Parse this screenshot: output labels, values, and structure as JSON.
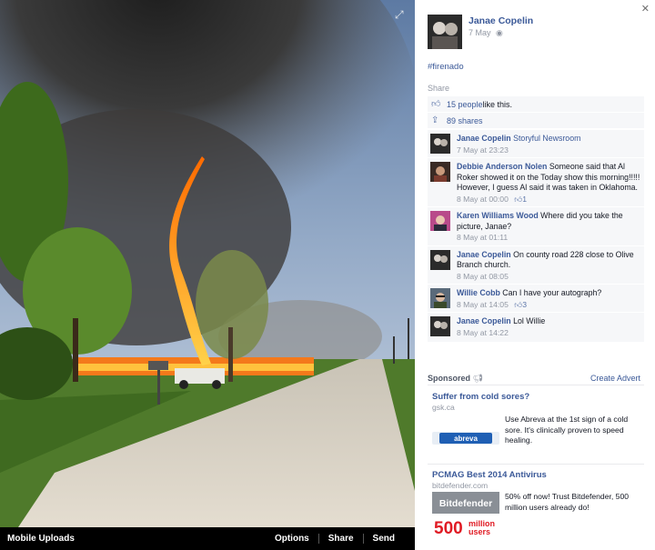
{
  "stage": {
    "album": "Mobile Uploads",
    "actions": [
      "Options",
      "Share",
      "Send"
    ]
  },
  "post": {
    "owner": "Janae Copelin",
    "date": "7 May",
    "caption": "#firenado",
    "share_label": "Share",
    "likes_text": "15 people",
    "likes_suffix": " like this.",
    "shares_text": "89 shares"
  },
  "comments": [
    {
      "name": "Janae Copelin",
      "text": "Storyful Newsroom",
      "time": "7 May at 23:23",
      "likes": "",
      "text_is_link": true
    },
    {
      "name": "Debbie Anderson Nolen",
      "text": "Someone said that Al Roker showed it on the Today show this morning!!!!! However, I guess Al said it was taken in Oklahoma.",
      "time": "8 May at 00:00",
      "likes": "1"
    },
    {
      "name": "Karen Williams Wood",
      "text": "Where did you take the picture, Janae?",
      "time": "8 May at 01:11",
      "likes": ""
    },
    {
      "name": "Janae Copelin",
      "text": "On county road 228 close to Olive Branch church.",
      "time": "8 May at 08:05",
      "likes": ""
    },
    {
      "name": "Willie Cobb",
      "text": "Can I have your autograph?",
      "time": "8 May at 14:05",
      "likes": "3"
    },
    {
      "name": "Janae Copelin",
      "text": "Lol Willie",
      "time": "8 May at 14:22",
      "likes": ""
    }
  ],
  "ads": {
    "sponsored_label": "Sponsored",
    "create_label": "Create Advert",
    "items": [
      {
        "title": "Suffer from cold sores?",
        "domain": "gsk.ca",
        "copy": "Use Abreva at the 1st sign of a cold sore. It's clinically proven to speed healing.",
        "brand": "abreva"
      },
      {
        "title": "PCMAG Best 2014 Antivirus",
        "domain": "bitdefender.com",
        "copy": "50% off now! Trust Bitdefender, 500 million users already do!",
        "brand": "Bitdefender",
        "badge_big": "500",
        "badge_small_1": "million",
        "badge_small_2": "users"
      }
    ]
  },
  "colors": {
    "link": "#3b5998",
    "meta": "#9197a3",
    "ufi_bg": "#f6f7f9",
    "bar_bg": "#000000"
  }
}
